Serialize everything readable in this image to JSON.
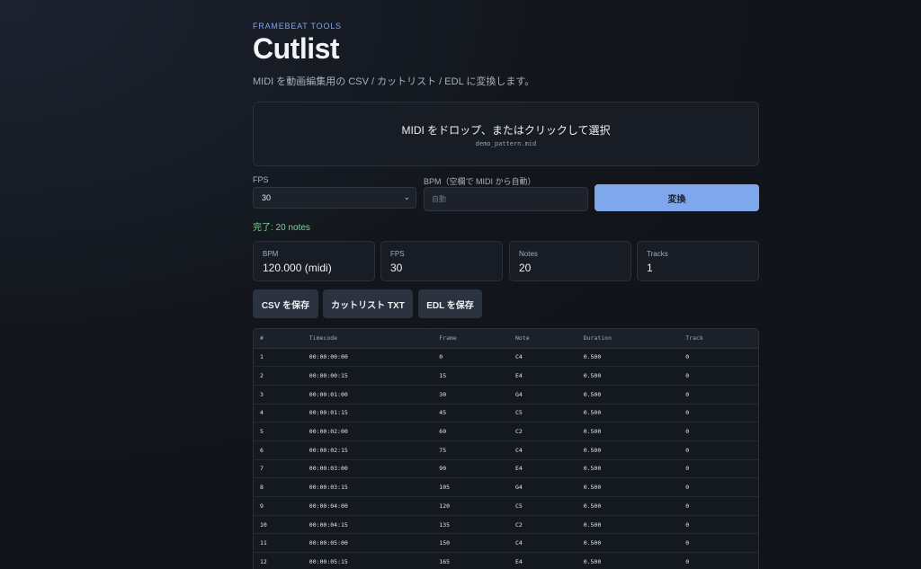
{
  "header": {
    "eyebrow": "FRAMEBEAT TOOLS",
    "title": "Cutlist",
    "subtitle": "MIDI を動画編集用の CSV / カットリスト / EDL に変換します。"
  },
  "dropzone": {
    "title": "MIDI をドロップ、またはクリックして選択",
    "filename": "demo_pattern.mid"
  },
  "form": {
    "fps_label": "FPS",
    "fps_value": "30",
    "bpm_label": "BPM（空欄で MIDI から自動）",
    "bpm_placeholder": "自動",
    "convert_label": "変換"
  },
  "status": "完了: 20 notes",
  "stats": [
    {
      "label": "BPM",
      "value": "120.000 (midi)"
    },
    {
      "label": "FPS",
      "value": "30"
    },
    {
      "label": "Notes",
      "value": "20"
    },
    {
      "label": "Tracks",
      "value": "1"
    }
  ],
  "actions": {
    "csv": "CSV を保存",
    "txt": "カットリスト TXT",
    "edl": "EDL を保存"
  },
  "table": {
    "headers": [
      "#",
      "Timecode",
      "Frame",
      "Note",
      "Duration",
      "Track"
    ],
    "rows": [
      [
        "1",
        "00:00:00:00",
        "0",
        "C4",
        "0.500",
        "0"
      ],
      [
        "2",
        "00:00:00:15",
        "15",
        "E4",
        "0.500",
        "0"
      ],
      [
        "3",
        "00:00:01:00",
        "30",
        "G4",
        "0.500",
        "0"
      ],
      [
        "4",
        "00:00:01:15",
        "45",
        "C5",
        "0.500",
        "0"
      ],
      [
        "5",
        "00:00:02:00",
        "60",
        "C2",
        "0.500",
        "0"
      ],
      [
        "6",
        "00:00:02:15",
        "75",
        "C4",
        "0.500",
        "0"
      ],
      [
        "7",
        "00:00:03:00",
        "90",
        "E4",
        "0.500",
        "0"
      ],
      [
        "8",
        "00:00:03:15",
        "105",
        "G4",
        "0.500",
        "0"
      ],
      [
        "9",
        "00:00:04:00",
        "120",
        "C5",
        "0.500",
        "0"
      ],
      [
        "10",
        "00:00:04:15",
        "135",
        "C2",
        "0.500",
        "0"
      ],
      [
        "11",
        "00:00:05:00",
        "150",
        "C4",
        "0.500",
        "0"
      ],
      [
        "12",
        "00:00:05:15",
        "165",
        "E4",
        "0.500",
        "0"
      ]
    ]
  },
  "colors": {
    "accent": "#7ea7ec",
    "success": "#7fd39a",
    "background": "#12151b"
  }
}
